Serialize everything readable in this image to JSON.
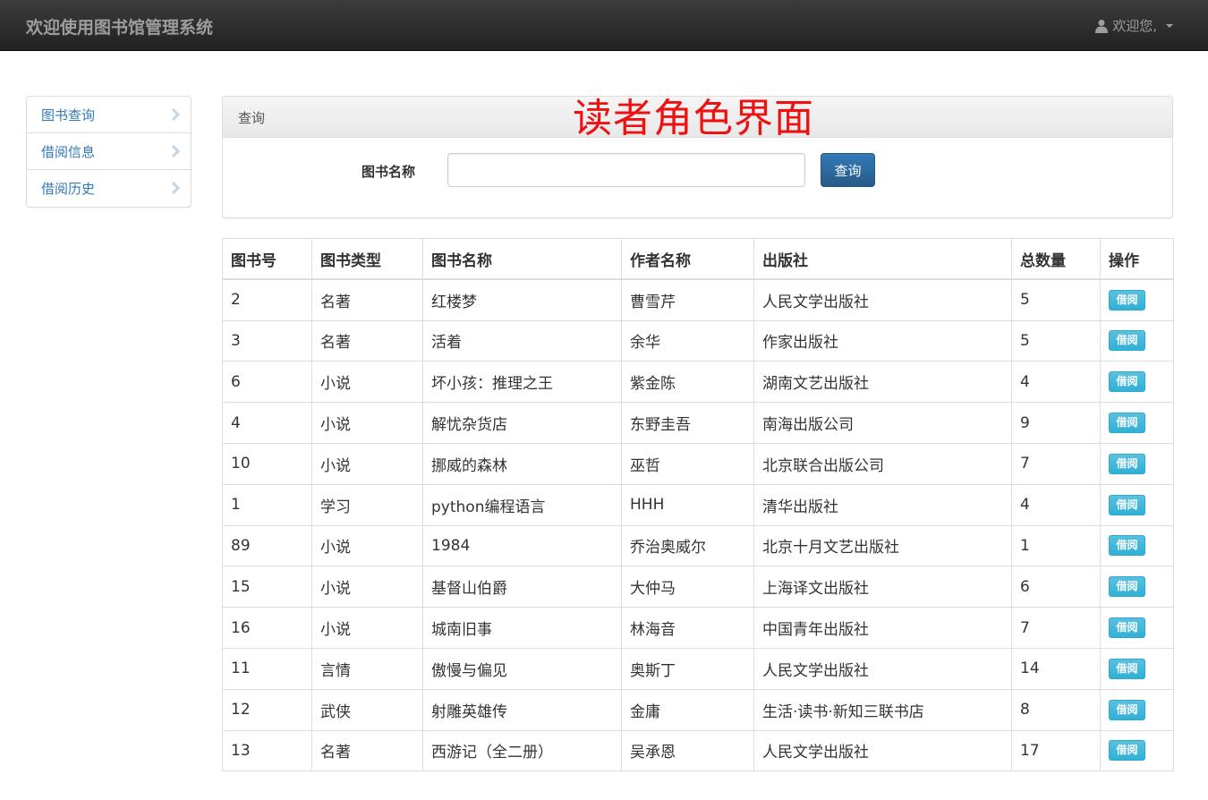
{
  "navbar": {
    "brand": "欢迎使用图书馆管理系统",
    "user_label": "欢迎您,"
  },
  "sidebar": {
    "items": [
      {
        "label": "图书查询"
      },
      {
        "label": "借阅信息"
      },
      {
        "label": "借阅历史"
      }
    ]
  },
  "panel": {
    "heading": "查询",
    "overlay_title": "读者角色界面",
    "search_label": "图书名称",
    "search_value": "",
    "search_button": "查询"
  },
  "table": {
    "headers": [
      "图书号",
      "图书类型",
      "图书名称",
      "作者名称",
      "出版社",
      "总数量",
      "操作"
    ],
    "action_label": "借阅",
    "rows": [
      [
        "2",
        "名著",
        "红楼梦",
        "曹雪芹",
        "人民文学出版社",
        "5"
      ],
      [
        "3",
        "名著",
        "活着",
        "余华",
        "作家出版社",
        "5"
      ],
      [
        "6",
        "小说",
        "坏小孩：推理之王",
        "紫金陈",
        "湖南文艺出版社",
        "4"
      ],
      [
        "4",
        "小说",
        "解忧杂货店",
        "东野圭吾",
        "南海出版公司",
        "9"
      ],
      [
        "10",
        "小说",
        "挪威的森林",
        "巫哲",
        "北京联合出版公司",
        "7"
      ],
      [
        "1",
        "学习",
        "python编程语言",
        "HHH",
        "清华出版社",
        "4"
      ],
      [
        "89",
        "小说",
        "1984",
        "乔治奥威尔",
        "北京十月文艺出版社",
        "1"
      ],
      [
        "15",
        "小说",
        "基督山伯爵",
        "大仲马",
        "上海译文出版社",
        "6"
      ],
      [
        "16",
        "小说",
        "城南旧事",
        "林海音",
        "中国青年出版社",
        "7"
      ],
      [
        "11",
        "言情",
        "傲慢与偏见",
        "奥斯丁",
        "人民文学出版社",
        "14"
      ],
      [
        "12",
        "武侠",
        "射雕英雄传",
        "金庸",
        "生活·读书·新知三联书店",
        "8"
      ],
      [
        "13",
        "名著",
        "西游记（全二册）",
        "吴承恩",
        "人民文学出版社",
        "17"
      ]
    ]
  },
  "colors": {
    "navbar": "#222222",
    "link": "#337ab7",
    "primary_button": "#337ab7",
    "info_button": "#5bc0de",
    "overlay_title": "#ee1111"
  },
  "icons": {
    "user": "user-icon",
    "dropdown": "caret-down-icon",
    "sidebar_item": "chevron-right-icon"
  }
}
